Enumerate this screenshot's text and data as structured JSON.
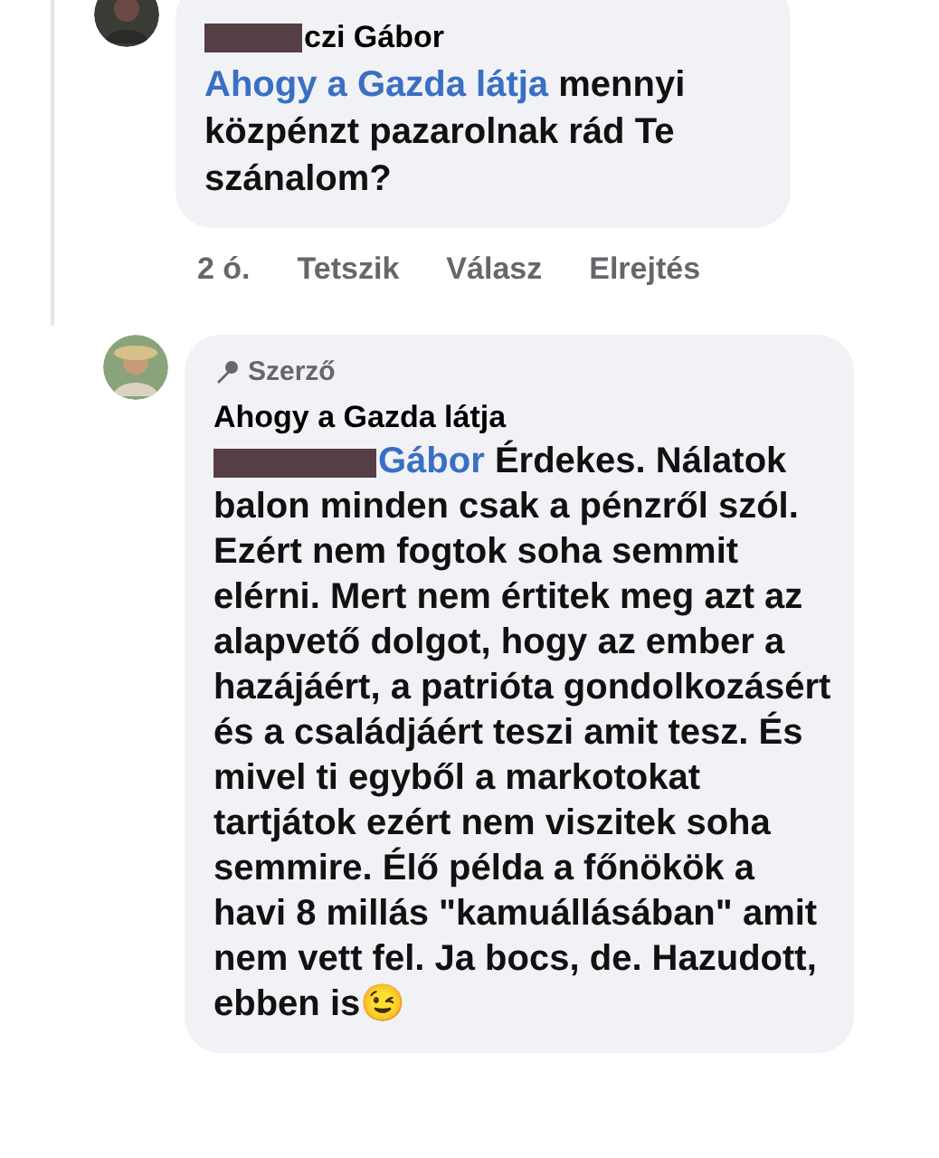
{
  "comments": [
    {
      "author": "czi Gábor",
      "author_redacted": true,
      "mention": "Ahogy a Gazda látja",
      "text": " mennyi közpénzt pazarolnak rád Te szánalom?",
      "actions": [
        "2 ó.",
        "Tetszik",
        "Válasz",
        "Elrejtés"
      ]
    },
    {
      "badge": "Szerző",
      "author": "Ahogy a Gazda látja",
      "mention": "Gábor",
      "mention_redacted": true,
      "text": " Érdekes. Nálatok balon minden csak a pénzről szól. Ezért nem fogtok soha semmit elérni. Mert nem értitek meg azt az alapvető dolgot, hogy az ember a hazájáért, a patrióta gondolkozásért és a családjáért teszi amit tesz. És mivel ti egyből a markotokat tartjátok ezért nem viszitek soha semmire. Élő példa a főnökök a  havi 8 millás \"kamuállásában\" amit nem vett fel. Ja bocs, de. Hazudott, ebben is😉"
    }
  ]
}
